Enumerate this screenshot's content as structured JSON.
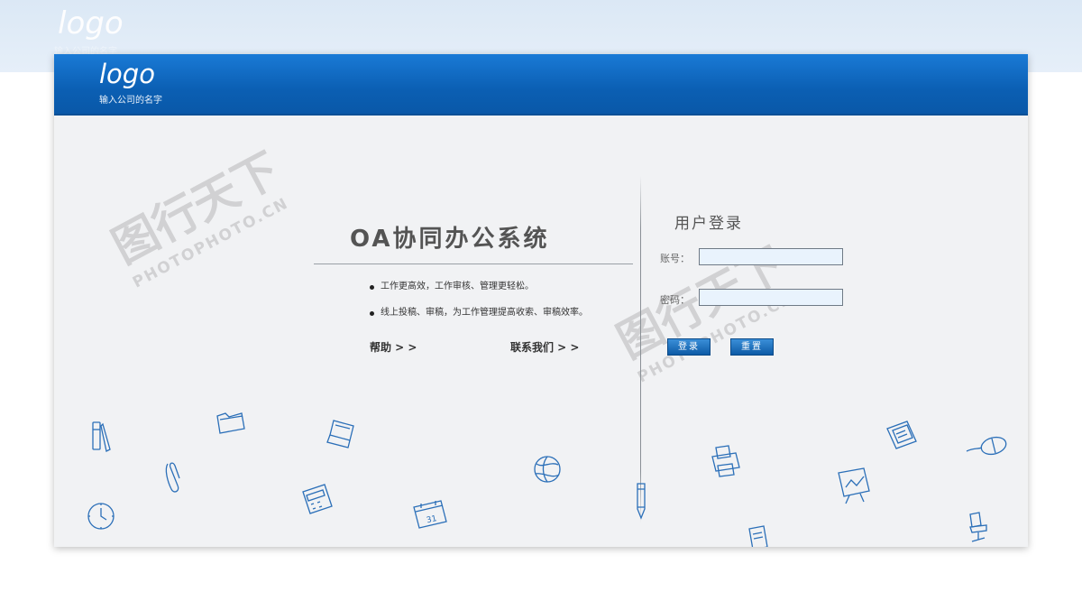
{
  "background": {
    "logo": "logo",
    "tagline": "输入公司的名字"
  },
  "header": {
    "logo": "logo",
    "company_name": "输入公司的名字"
  },
  "intro": {
    "title": "OA协同办公系统",
    "bullets": [
      "工作更高效，工作审核、管理更轻松。",
      "线上投稿、审稿，为工作管理提高收索、审稿效率。"
    ],
    "help_link": "帮助 > >",
    "contact_link": "联系我们 > >"
  },
  "login": {
    "title": "用户登录",
    "account_label": "账号：",
    "password_label": "密码：",
    "account_value": "",
    "password_value": "",
    "login_button": "登录",
    "reset_button": "重置"
  },
  "watermark": {
    "main": "图行天下",
    "sub": "PHOTOPHOTO.CN"
  },
  "colors": {
    "header_blue": "#0b5fb3",
    "panel_bg": "#f1f2f4",
    "button_blue": "#1470c2",
    "doodle_blue": "#2b6fb8"
  },
  "icons": [
    "pencil-icon",
    "folder-icon",
    "laptop-icon",
    "paperclip-icon",
    "clock-icon",
    "calculator-icon",
    "calendar-icon",
    "globe-icon",
    "pen-icon",
    "printer-icon",
    "notebook-icon",
    "chart-board-icon",
    "mouse-icon",
    "desk-chair-icon",
    "document-icon"
  ]
}
